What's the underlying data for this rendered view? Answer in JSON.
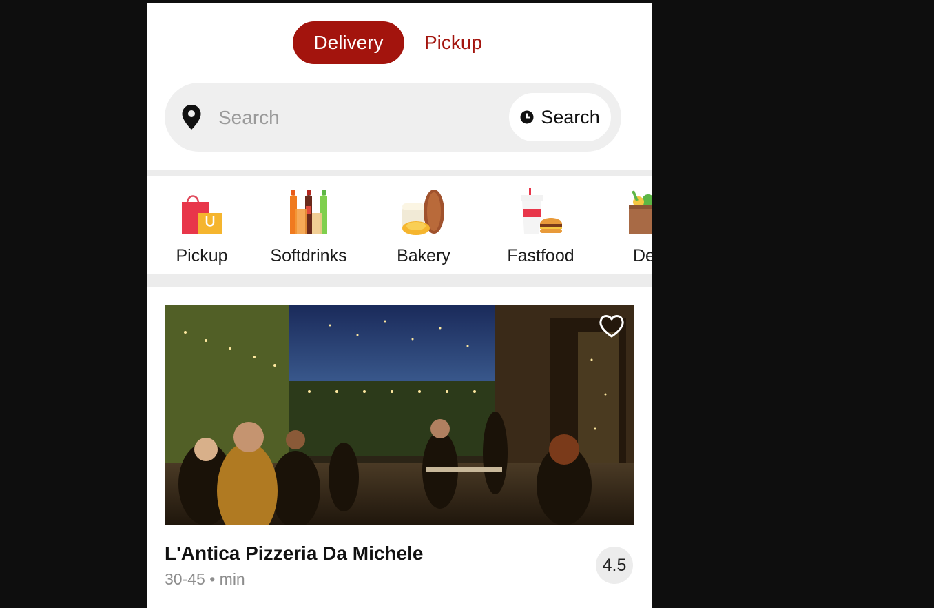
{
  "mode_toggle": {
    "delivery_label": "Delivery",
    "pickup_label": "Pickup",
    "active": "Delivery",
    "accent_color": "#a3140d"
  },
  "search": {
    "placeholder": "Search",
    "value": "",
    "icon": "location-pin-icon",
    "schedule_button_label": "Search",
    "schedule_button_icon": "clock-icon"
  },
  "categories": [
    {
      "label": "Pickup",
      "icon": "shopping-bags-icon"
    },
    {
      "label": "Softdrinks",
      "icon": "soda-bottles-icon"
    },
    {
      "label": "Bakery",
      "icon": "bread-icon"
    },
    {
      "label": "Fastfood",
      "icon": "burger-drink-icon"
    },
    {
      "label": "De",
      "icon": "grocery-bag-icon"
    }
  ],
  "restaurant": {
    "name": "L'Antica Pizzeria Da Michele",
    "delivery_time": "30-45 • min",
    "rating": "4.5",
    "favorite_icon": "heart-outline-icon"
  }
}
